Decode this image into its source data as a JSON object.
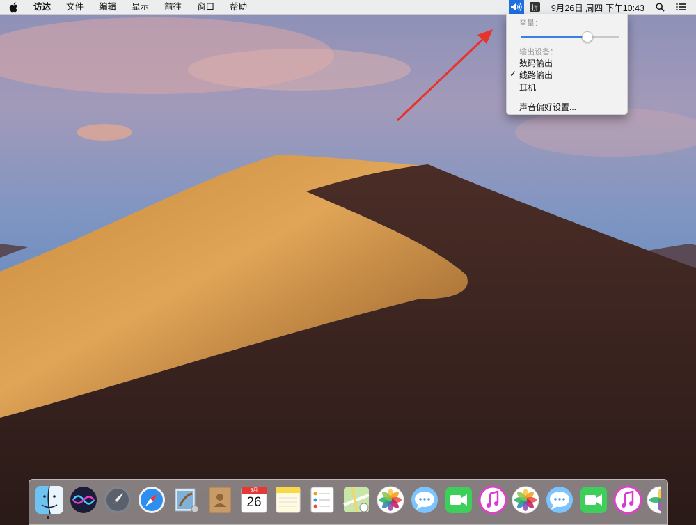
{
  "menubar": {
    "app_name": "访达",
    "menus": [
      "文件",
      "编辑",
      "显示",
      "前往",
      "窗口",
      "帮助"
    ],
    "input_method": "拼",
    "clock": "9月26日 周四 下午10:43"
  },
  "volume_menu": {
    "volume_label": "音量：",
    "volume_level": 0.67,
    "output_label": "输出设备：",
    "devices": [
      "数码输出",
      "线路输出",
      "耳机"
    ],
    "selected_device": "线路输出",
    "check_mark": "✓",
    "preferences": "声音偏好设置..."
  },
  "dock": {
    "calendar_month": "9月",
    "calendar_day": "26",
    "items": [
      "finder-icon",
      "siri-icon",
      "launchpad-icon",
      "safari-icon",
      "mail-icon",
      "contacts-icon",
      "calendar-icon",
      "notes-icon",
      "reminders-icon",
      "maps-icon",
      "photos-icon",
      "messages-icon",
      "facetime-icon",
      "itunes-icon",
      "photos-icon",
      "messages-icon",
      "facetime-icon",
      "itunes-icon",
      "photos-icon"
    ]
  },
  "colors": {
    "menu_highlight": "#1f6fe0",
    "arrow": "#e8322c"
  }
}
